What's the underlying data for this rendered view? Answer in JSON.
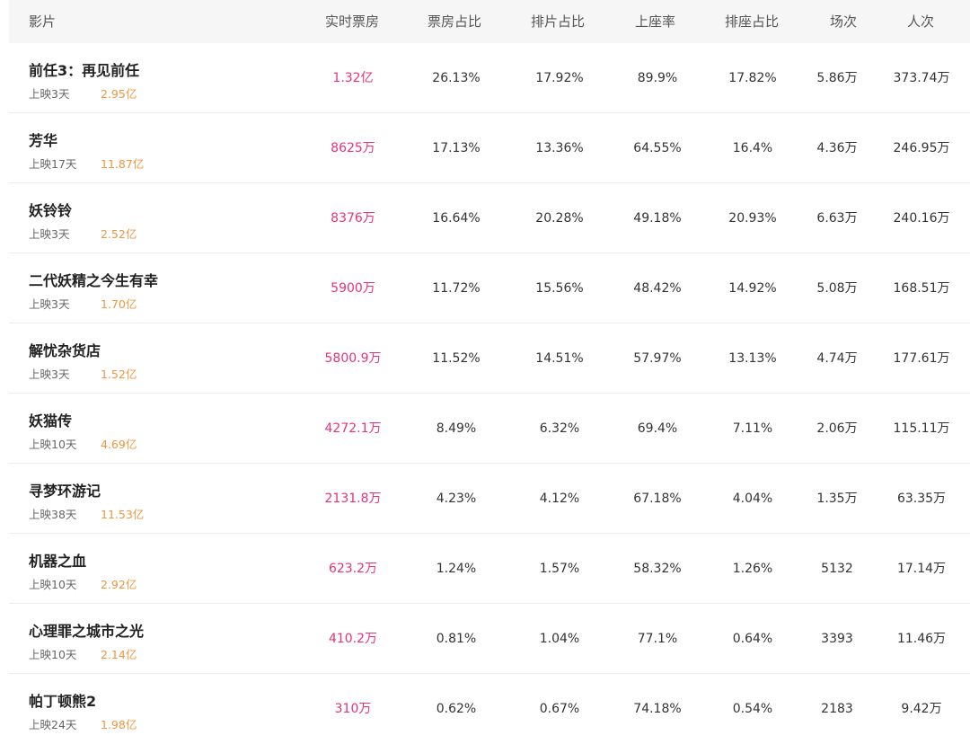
{
  "header": {
    "movie": "影片",
    "realtime_box_office": "实时票房",
    "box_office_share": "票房占比",
    "screening_share": "排片占比",
    "occupancy_rate": "上座率",
    "seat_share": "排座占比",
    "shows": "场次",
    "admissions": "人次"
  },
  "rows": [
    {
      "name": "前任3：再见前任",
      "days": "上映3天",
      "total": "2.95亿",
      "box_office": "1.32亿",
      "bo_share": "26.13%",
      "screen_share": "17.92%",
      "occupancy": "89.9%",
      "seat_share": "17.82%",
      "shows": "5.86万",
      "admissions": "373.74万"
    },
    {
      "name": "芳华",
      "days": "上映17天",
      "total": "11.87亿",
      "box_office": "8625万",
      "bo_share": "17.13%",
      "screen_share": "13.36%",
      "occupancy": "64.55%",
      "seat_share": "16.4%",
      "shows": "4.36万",
      "admissions": "246.95万"
    },
    {
      "name": "妖铃铃",
      "days": "上映3天",
      "total": "2.52亿",
      "box_office": "8376万",
      "bo_share": "16.64%",
      "screen_share": "20.28%",
      "occupancy": "49.18%",
      "seat_share": "20.93%",
      "shows": "6.63万",
      "admissions": "240.16万"
    },
    {
      "name": "二代妖精之今生有幸",
      "days": "上映3天",
      "total": "1.70亿",
      "box_office": "5900万",
      "bo_share": "11.72%",
      "screen_share": "15.56%",
      "occupancy": "48.42%",
      "seat_share": "14.92%",
      "shows": "5.08万",
      "admissions": "168.51万"
    },
    {
      "name": "解忧杂货店",
      "days": "上映3天",
      "total": "1.52亿",
      "box_office": "5800.9万",
      "bo_share": "11.52%",
      "screen_share": "14.51%",
      "occupancy": "57.97%",
      "seat_share": "13.13%",
      "shows": "4.74万",
      "admissions": "177.61万"
    },
    {
      "name": "妖猫传",
      "days": "上映10天",
      "total": "4.69亿",
      "box_office": "4272.1万",
      "bo_share": "8.49%",
      "screen_share": "6.32%",
      "occupancy": "69.4%",
      "seat_share": "7.11%",
      "shows": "2.06万",
      "admissions": "115.11万"
    },
    {
      "name": "寻梦环游记",
      "days": "上映38天",
      "total": "11.53亿",
      "box_office": "2131.8万",
      "bo_share": "4.23%",
      "screen_share": "4.12%",
      "occupancy": "67.18%",
      "seat_share": "4.04%",
      "shows": "1.35万",
      "admissions": "63.35万"
    },
    {
      "name": "机器之血",
      "days": "上映10天",
      "total": "2.92亿",
      "box_office": "623.2万",
      "bo_share": "1.24%",
      "screen_share": "1.57%",
      "occupancy": "58.32%",
      "seat_share": "1.26%",
      "shows": "5132",
      "admissions": "17.14万"
    },
    {
      "name": "心理罪之城市之光",
      "days": "上映10天",
      "total": "2.14亿",
      "box_office": "410.2万",
      "bo_share": "0.81%",
      "screen_share": "1.04%",
      "occupancy": "77.1%",
      "seat_share": "0.64%",
      "shows": "3393",
      "admissions": "11.46万"
    },
    {
      "name": "帕丁顿熊2",
      "days": "上映24天",
      "total": "1.98亿",
      "box_office": "310万",
      "bo_share": "0.62%",
      "screen_share": "0.67%",
      "occupancy": "74.18%",
      "seat_share": "0.54%",
      "shows": "2183",
      "admissions": "9.42万"
    }
  ]
}
